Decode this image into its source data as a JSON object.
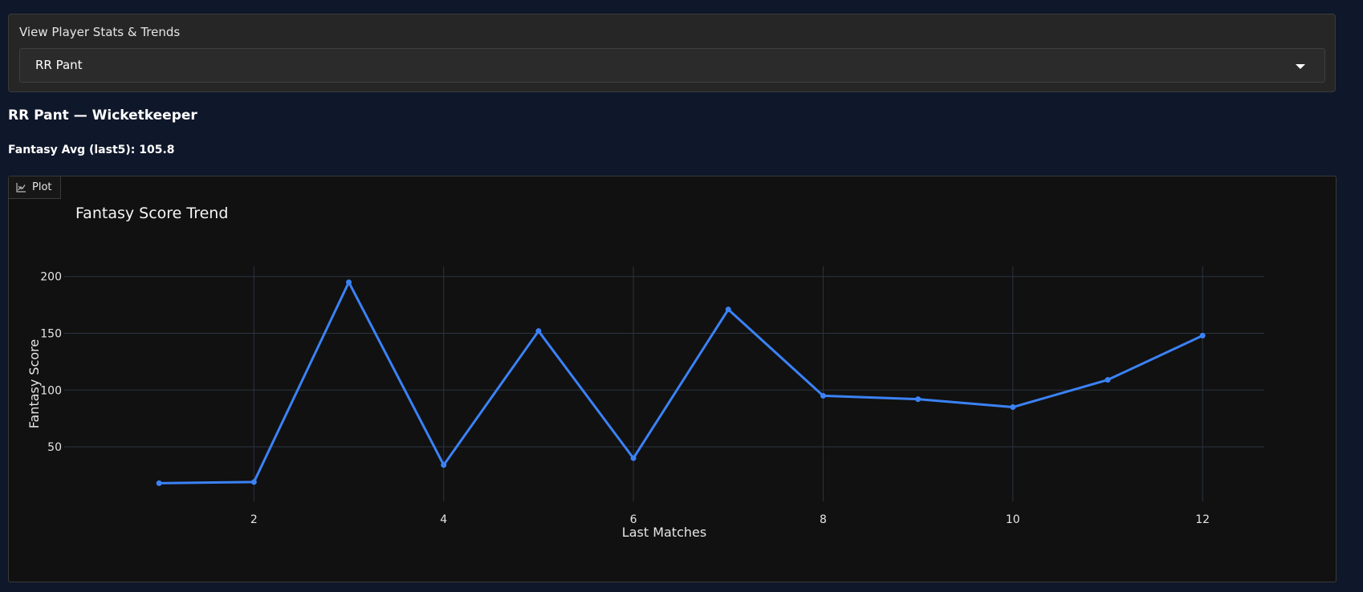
{
  "selector": {
    "label": "View Player Stats & Trends",
    "selected": "RR Pant"
  },
  "player": {
    "heading": "RR Pant — Wicketkeeper",
    "avg_text": "Fantasy Avg (last5): 105.8"
  },
  "plot_tab": {
    "label": "Plot",
    "icon": "chart-icon"
  },
  "colors": {
    "page_bg": "#0f172a",
    "panel_bg": "#111111",
    "line": "#3b82f6",
    "grid": "#2b3441"
  },
  "chart_data": {
    "type": "line",
    "title": "Fantasy Score Trend",
    "xlabel": "Last Matches",
    "ylabel": "Fantasy Score",
    "x": [
      1,
      2,
      3,
      4,
      5,
      6,
      7,
      8,
      9,
      10,
      11,
      12
    ],
    "y": [
      18,
      19,
      195,
      34,
      152,
      40,
      171,
      95,
      92,
      85,
      109,
      148
    ],
    "x_ticks": [
      2,
      4,
      6,
      8,
      10,
      12
    ],
    "y_ticks": [
      50,
      100,
      150,
      200
    ],
    "xlim": [
      0.0,
      12.65
    ],
    "ylim": [
      2,
      209
    ],
    "grid": true,
    "legend": "none"
  }
}
